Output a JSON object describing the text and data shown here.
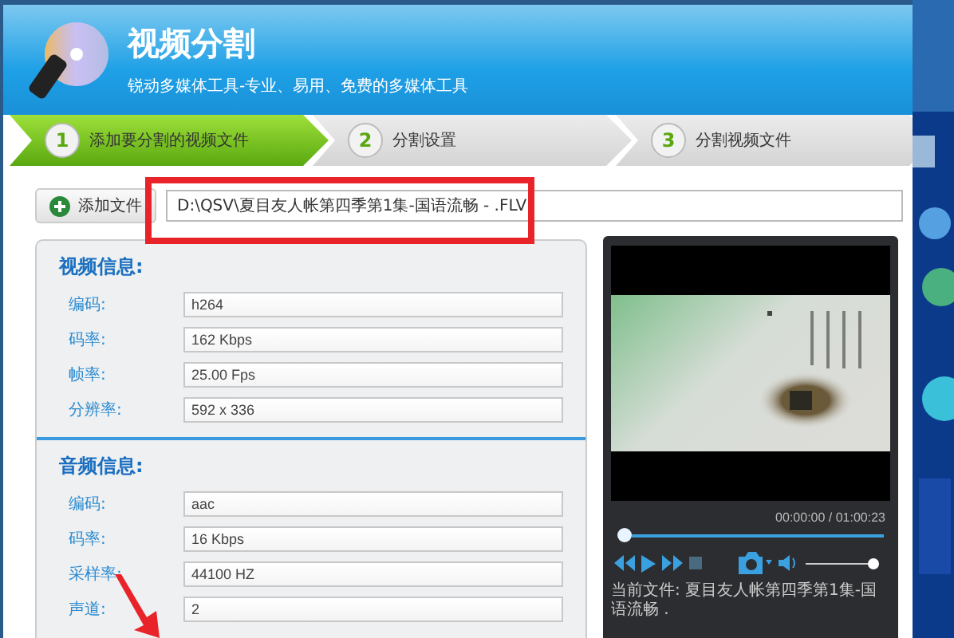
{
  "header": {
    "title": "视频分割",
    "subtitle": "锐动多媒体工具-专业、易用、免费的多媒体工具"
  },
  "steps": [
    {
      "number": "1",
      "label": "添加要分割的视频文件",
      "selected": true
    },
    {
      "number": "2",
      "label": "分割设置",
      "selected": false
    },
    {
      "number": "3",
      "label": "分割视频文件",
      "selected": false
    }
  ],
  "add_button": "添加文件",
  "file_path": "D:\\QSV\\夏目友人帐第四季第1集-国语流畅 - .FLV",
  "sections": [
    {
      "heading": "视频信息:",
      "fields": [
        {
          "label": "编码:",
          "value": "h264"
        },
        {
          "label": "码率:",
          "value": "162 Kbps"
        },
        {
          "label": "帧率:",
          "value": "25.00 Fps"
        },
        {
          "label": "分辨率:",
          "value": "592 x 336"
        }
      ]
    },
    {
      "heading": "音频信息:",
      "fields": [
        {
          "label": "编码:",
          "value": "aac"
        },
        {
          "label": "码率:",
          "value": "16 Kbps"
        },
        {
          "label": "采样率:",
          "value": "44100 HZ"
        },
        {
          "label": "声道:",
          "value": "2"
        }
      ]
    }
  ],
  "player": {
    "time": "00:00:00 / 01:00:23",
    "progress": {
      "level": 0
    },
    "volume": {
      "level": 1
    },
    "current_file": "当前文件: 夏目友人帐第四季第1集-国语流畅 ."
  }
}
